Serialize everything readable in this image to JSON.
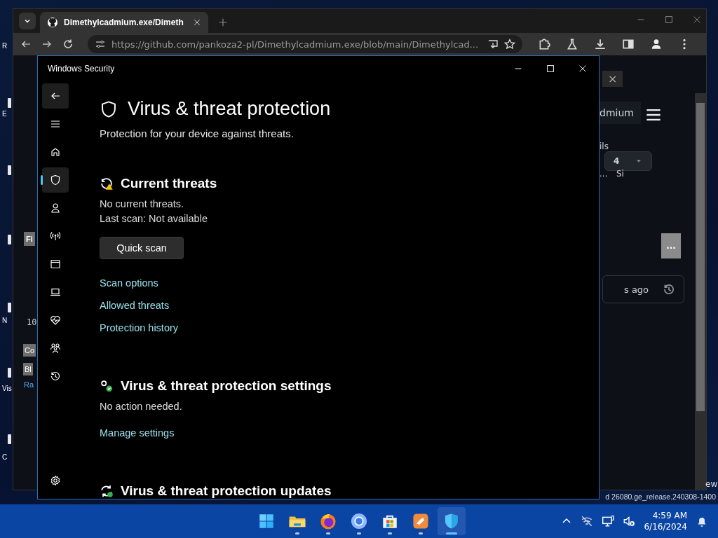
{
  "desktop": {
    "icon_labels": [
      "R",
      "E",
      "N",
      "Vis",
      "C"
    ],
    "build_text": "d 26080.ge_release.240308-1400",
    "corner_text": "ew"
  },
  "browser": {
    "tab_title": "Dimethylcadmium.exe/Dimeth",
    "url": "https://github.com/pankoza2-pl/Dimethylcadmium.exe/blob/main/Dimethylcad...",
    "fragments": [
      {
        "kind": "header",
        "text": "dmium"
      },
      {
        "kind": "plain",
        "text": "ils"
      },
      {
        "kind": "count",
        "text": "4"
      },
      {
        "kind": "plain",
        "text": "Si"
      },
      {
        "kind": "plain",
        "text": "..."
      },
      {
        "kind": "more",
        "text": "..."
      },
      {
        "kind": "card",
        "text": "s ago"
      },
      {
        "kind": "back",
        "text": "Fi"
      },
      {
        "kind": "code",
        "text": "10"
      },
      {
        "kind": "tool",
        "text": "Co"
      },
      {
        "kind": "tool",
        "text": "Bl"
      },
      {
        "kind": "link",
        "text": "Ra"
      },
      {
        "kind": "popup",
        "text": "×"
      }
    ]
  },
  "security_window": {
    "title": "Windows Security",
    "nav": [
      {
        "kind": "back",
        "selected": false
      },
      {
        "kind": "menu",
        "selected": false
      },
      {
        "kind": "home",
        "selected": false
      },
      {
        "kind": "shield",
        "selected": true
      },
      {
        "kind": "account",
        "selected": false
      },
      {
        "kind": "network",
        "selected": false
      },
      {
        "kind": "app",
        "selected": false
      },
      {
        "kind": "device",
        "selected": false
      },
      {
        "kind": "health",
        "selected": false
      },
      {
        "kind": "family",
        "selected": false
      },
      {
        "kind": "history",
        "selected": false
      },
      {
        "kind": "settings",
        "selected": false
      }
    ],
    "page_title": "Virus & threat protection",
    "page_subtitle": "Protection for your device against threats.",
    "sections": [
      {
        "kind": "threats",
        "title": "Current threats",
        "lines": [
          "No current threats.",
          "Last scan: Not available"
        ],
        "button": "Quick scan",
        "links": [
          "Scan options",
          "Allowed threats",
          "Protection history"
        ]
      },
      {
        "kind": "settings",
        "title": "Virus & threat protection settings",
        "lines": [
          "No action needed."
        ],
        "links": [
          "Manage settings"
        ]
      },
      {
        "kind": "updates",
        "title": "Virus & threat protection updates"
      }
    ]
  },
  "taskbar": {
    "apps": [
      {
        "kind": "start",
        "running": false,
        "active": false
      },
      {
        "kind": "explorer",
        "running": true,
        "active": false
      },
      {
        "kind": "firefox",
        "running": true,
        "active": false
      },
      {
        "kind": "chrome",
        "running": true,
        "active": false
      },
      {
        "kind": "store",
        "running": true,
        "active": false
      },
      {
        "kind": "orange",
        "running": true,
        "active": false
      },
      {
        "kind": "defender",
        "running": true,
        "active": true
      }
    ],
    "time": "4:59 AM",
    "date": "6/16/2024"
  }
}
